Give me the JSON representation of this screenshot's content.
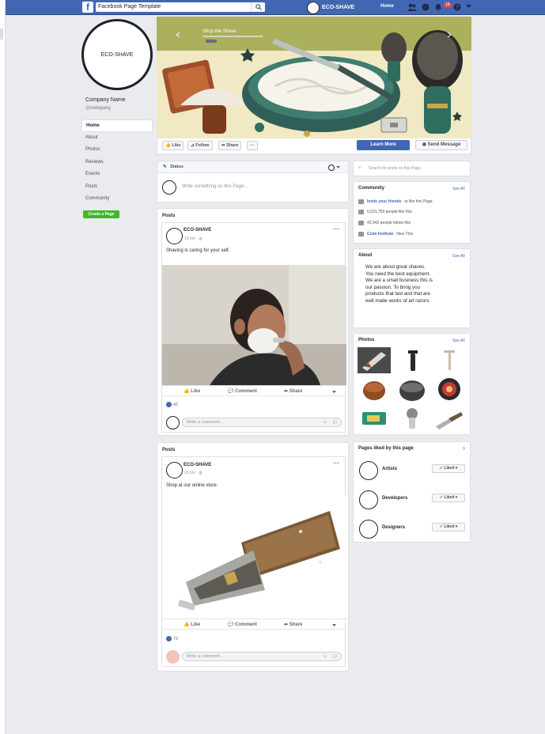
{
  "topbar": {
    "search_value": "Facebook Page Template",
    "brand_name": "ECO-SHAVE",
    "home_label": "Home",
    "notification_count": "18",
    "colors": {
      "bar": "#4267b2"
    }
  },
  "sidebar": {
    "profile_text": "ECO-SHAVE",
    "company_name": "Company Name",
    "company_handle": "@company",
    "items": [
      {
        "label": "Home"
      },
      {
        "label": "About"
      },
      {
        "label": "Photos"
      },
      {
        "label": "Reviews"
      },
      {
        "label": "Events"
      },
      {
        "label": "Posts"
      },
      {
        "label": "Community"
      }
    ],
    "create_page_label": "Create a Page"
  },
  "cover": {
    "overlay_title": "Shop the Shave",
    "icons": [
      "shaving-brush-icon",
      "razor-icon",
      "lather-bowl-icon"
    ]
  },
  "actions": {
    "like": "Like",
    "follow": "Follow",
    "share": "Share",
    "more": "···",
    "learn_more": "Learn More",
    "send_message": "Send Message"
  },
  "composer": {
    "status_label": "Status",
    "placeholder": "Write something on this Page..."
  },
  "posts": [
    {
      "section_title": "Posts",
      "author": "ECO-SHAVE",
      "time": "10 hrs",
      "text": "Shaving is caring for your self.",
      "likes": "42",
      "comment_placeholder": "Write a comment...",
      "buttons": {
        "like": "Like",
        "comment": "Comment",
        "share": "Share"
      }
    },
    {
      "section_title": "Posts",
      "author": "ECO-SHAVE",
      "time": "23 hrs",
      "text": "Shop at our online store.",
      "likes": "73",
      "comment_placeholder": "Write a comment...",
      "buttons": {
        "like": "Like",
        "comment": "Comment",
        "share": "Share"
      }
    }
  ],
  "right": {
    "search_placeholder": "Search for posts on this Page",
    "community": {
      "title": "Community",
      "see_all": "See All",
      "rows": [
        {
          "link": "Invite your friends",
          "text": "to like this Page"
        },
        {
          "link": "",
          "text": "6,031,769 people like this"
        },
        {
          "link": "",
          "text": "42,042 people follow this"
        },
        {
          "link": "Code Institute",
          "text": "likes This"
        }
      ]
    },
    "about": {
      "title": "About",
      "see_all": "See All",
      "lines": [
        "We are about great shaves.",
        "You need the best equipment.",
        "We are a small business this is",
        "our passion. To bring you",
        "products that last and that are",
        "well made works of art razors."
      ]
    },
    "photos": {
      "title": "Photos",
      "see_all": "See All"
    },
    "liked_pages": {
      "title": "Pages liked by this page",
      "pages": [
        {
          "name": "Artists",
          "button": "Liked"
        },
        {
          "name": "Developers",
          "button": "Liked"
        },
        {
          "name": "Designers",
          "button": "Liked"
        }
      ]
    }
  }
}
